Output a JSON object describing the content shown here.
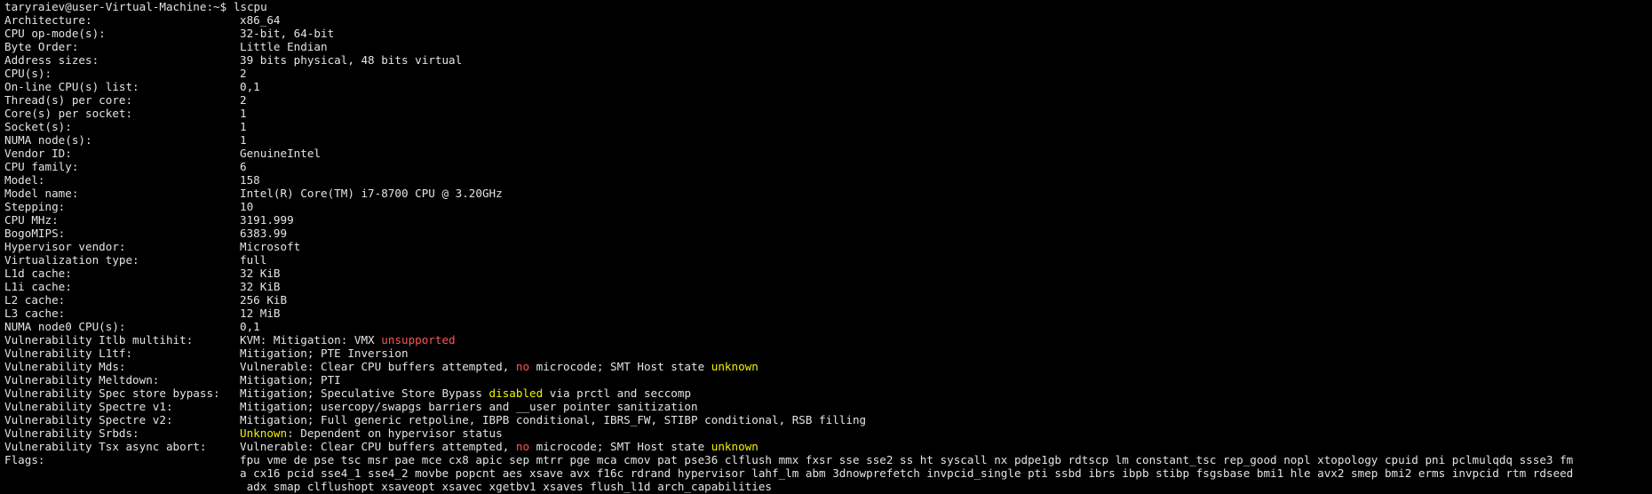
{
  "prompt": {
    "user_host": "taryraiev@user-Virtual-Machine:~$",
    "command": "lscpu"
  },
  "rows": [
    {
      "key": "Architecture:",
      "value": "x86_64"
    },
    {
      "key": "CPU op-mode(s):",
      "value": "32-bit, 64-bit"
    },
    {
      "key": "Byte Order:",
      "value": "Little Endian"
    },
    {
      "key": "Address sizes:",
      "value": "39 bits physical, 48 bits virtual"
    },
    {
      "key": "CPU(s):",
      "value": "2"
    },
    {
      "key": "On-line CPU(s) list:",
      "value": "0,1"
    },
    {
      "key": "Thread(s) per core:",
      "value": "2"
    },
    {
      "key": "Core(s) per socket:",
      "value": "1"
    },
    {
      "key": "Socket(s):",
      "value": "1"
    },
    {
      "key": "NUMA node(s):",
      "value": "1"
    },
    {
      "key": "Vendor ID:",
      "value": "GenuineIntel"
    },
    {
      "key": "CPU family:",
      "value": "6"
    },
    {
      "key": "Model:",
      "value": "158"
    },
    {
      "key": "Model name:",
      "value": "Intel(R) Core(TM) i7-8700 CPU @ 3.20GHz"
    },
    {
      "key": "Stepping:",
      "value": "10"
    },
    {
      "key": "CPU MHz:",
      "value": "3191.999"
    },
    {
      "key": "BogoMIPS:",
      "value": "6383.99"
    },
    {
      "key": "Hypervisor vendor:",
      "value": "Microsoft"
    },
    {
      "key": "Virtualization type:",
      "value": "full"
    },
    {
      "key": "L1d cache:",
      "value": "32 KiB"
    },
    {
      "key": "L1i cache:",
      "value": "32 KiB"
    },
    {
      "key": "L2 cache:",
      "value": "256 KiB"
    },
    {
      "key": "L3 cache:",
      "value": "12 MiB"
    },
    {
      "key": "NUMA node0 CPU(s):",
      "value": "0,1"
    }
  ],
  "vuln": {
    "itlb": {
      "key": "Vulnerability Itlb multihit:",
      "pre": "KVM: Mitigation: VMX ",
      "red": "unsupported"
    },
    "l1tf": {
      "key": "Vulnerability L1tf:",
      "value": "Mitigation; PTE Inversion"
    },
    "mds": {
      "key": "Vulnerability Mds:",
      "pre": "Vulnerable: Clear CPU buffers attempted, ",
      "red": "no",
      "mid": " microcode; SMT Host state ",
      "yellow": "unknown"
    },
    "meltdown": {
      "key": "Vulnerability Meltdown:",
      "value": "Mitigation; PTI"
    },
    "ssb": {
      "key": "Vulnerability Spec store bypass:",
      "pre": "Mitigation; Speculative Store Bypass ",
      "yellow": "disabled",
      "post": " via prctl and seccomp"
    },
    "spectre1": {
      "key": "Vulnerability Spectre v1:",
      "value": "Mitigation; usercopy/swapgs barriers and __user pointer sanitization"
    },
    "spectre2": {
      "key": "Vulnerability Spectre v2:",
      "value": "Mitigation; Full generic retpoline, IBPB conditional, IBRS_FW, STIBP conditional, RSB filling"
    },
    "srbds": {
      "key": "Vulnerability Srbds:",
      "yellow": "Unknown",
      "post": ": Dependent on hypervisor status"
    },
    "tsx": {
      "key": "Vulnerability Tsx async abort:",
      "pre": "Vulnerable: Clear CPU buffers attempted, ",
      "red": "no",
      "mid": " microcode; SMT Host state ",
      "yellow": "unknown"
    }
  },
  "flags": {
    "key": "Flags:",
    "line1": "fpu vme de pse tsc msr pae mce cx8 apic sep mtrr pge mca cmov pat pse36 clflush mmx fxsr sse sse2 ss ht syscall nx pdpe1gb rdtscp lm constant_tsc rep_good nopl xtopology cpuid pni pclmulqdq ssse3 fm",
    "line2": "a cx16 pcid sse4_1 sse4_2 movbe popcnt aes xsave avx f16c rdrand hypervisor lahf_lm abm 3dnowprefetch invpcid_single pti ssbd ibrs ibpb stibp fsgsbase bmi1 hle avx2 smep bmi2 erms invpcid rtm rdseed",
    "line3": " adx smap clflushopt xsaveopt xsavec xgetbv1 xsaves flush_l1d arch_capabilities"
  },
  "colors": {
    "background": "#000000",
    "text": "#e4e4e4",
    "red": "#ff5555",
    "yellow": "#f2f200"
  }
}
